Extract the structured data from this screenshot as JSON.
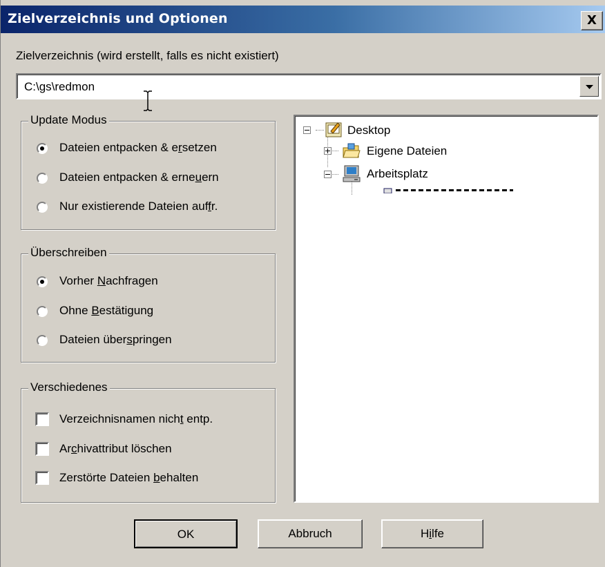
{
  "window": {
    "title": "Zielverzeichnis und Optionen",
    "close_label": "X"
  },
  "target": {
    "label": "Zielverzeichnis (wird erstellt, falls es nicht existiert)",
    "value": "C:\\gs\\redmon"
  },
  "update_mode": {
    "title": "Update Modus",
    "options": [
      {
        "pre": "Dateien entpacken & e",
        "acc": "r",
        "post": "setzen",
        "checked": true
      },
      {
        "pre": "Dateien entpacken & erne",
        "acc": "u",
        "post": "ern",
        "checked": false
      },
      {
        "pre": "Nur existierende Dateien auf",
        "acc": "f",
        "post": "r.",
        "checked": false
      }
    ]
  },
  "overwrite": {
    "title": "Überschreiben",
    "options": [
      {
        "pre": "Vorher ",
        "acc": "N",
        "post": "achfragen",
        "checked": true
      },
      {
        "pre": "Ohne ",
        "acc": "B",
        "post": "estätigung",
        "checked": false
      },
      {
        "pre": "Dateien über",
        "acc": "s",
        "post": "pringen",
        "checked": false
      }
    ]
  },
  "misc": {
    "title": "Verschiedenes",
    "options": [
      {
        "pre": "Verzeichnisnamen nich",
        "acc": "t",
        "post": " entp.",
        "checked": false
      },
      {
        "pre": "Ar",
        "acc": "c",
        "post": "hivattribut löschen",
        "checked": false
      },
      {
        "pre": "Zerstörte Dateien ",
        "acc": "b",
        "post": "ehalten",
        "checked": false
      }
    ]
  },
  "tree": {
    "items": [
      {
        "label": "Desktop",
        "icon": "desktop-icon",
        "expander": "minus"
      },
      {
        "label": "Eigene Dateien",
        "icon": "my-documents-folder-icon",
        "expander": "plus"
      },
      {
        "label": "Arbeitsplatz",
        "icon": "my-computer-icon",
        "expander": "minus"
      }
    ]
  },
  "buttons": {
    "ok": "OK",
    "cancel": "Abbruch",
    "help_pre": "H",
    "help_acc": "i",
    "help_post": "lfe"
  }
}
